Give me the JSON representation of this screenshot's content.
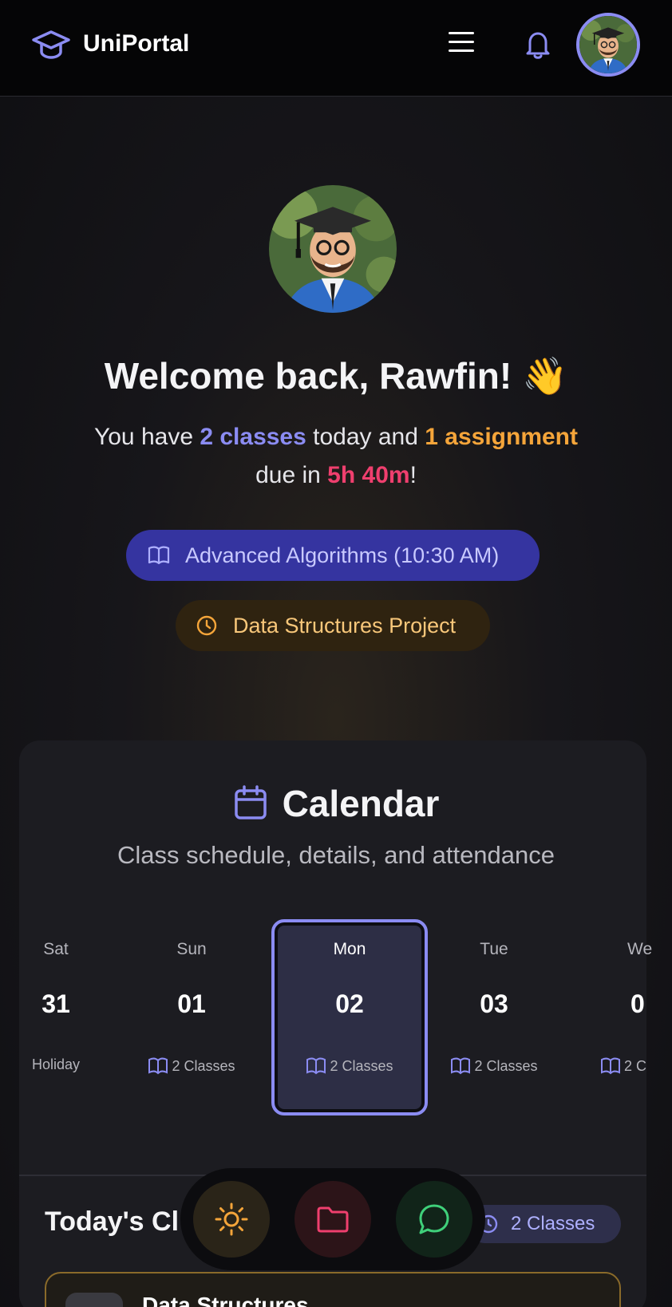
{
  "header": {
    "app_name": "UniPortal",
    "logo_icon": "graduation-cap-icon",
    "menu_icon": "hamburger-menu-icon",
    "bell_icon": "bell-icon",
    "accent_color": "#8b8cf2"
  },
  "hero": {
    "welcome": "Welcome back, Rawfin! 👋",
    "line_prefix": "You have ",
    "classes_highlight": "2 classes",
    "line_mid": " today and ",
    "assignment_highlight": "1 assignment",
    "line_due": " due in ",
    "due_highlight": "5h 40m",
    "line_end": "!",
    "next_class": "Advanced Algorithms (10:30 AM)",
    "next_task": "Data Structures Project"
  },
  "calendar": {
    "title": "Calendar",
    "subtitle": "Class schedule, details, and attendance",
    "days": [
      {
        "name": "Sat",
        "num": "31",
        "status": "Holiday"
      },
      {
        "name": "Sun",
        "num": "01",
        "status": "2 Classes"
      },
      {
        "name": "Mon",
        "num": "02",
        "status": "2 Classes"
      },
      {
        "name": "Tue",
        "num": "03",
        "status": "2 Classes"
      },
      {
        "name": "We",
        "num": "0",
        "status": "2 C"
      }
    ],
    "selected_day": "Mon"
  },
  "today": {
    "title": "Today's Cl",
    "badge": "2 Classes",
    "first_class": "Data Structures"
  },
  "dock": {
    "items": [
      "sun-icon",
      "folder-icon",
      "chat-bubble-icon"
    ],
    "colors": [
      "#f5a53a",
      "#ef3f6e",
      "#3fd07a"
    ]
  }
}
